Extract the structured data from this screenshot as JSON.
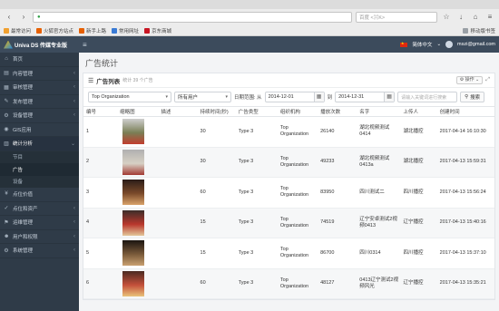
{
  "browser": {
    "url_hint": "百度 <⌘K>",
    "bookmarks": [
      {
        "label": "最常访问",
        "color": "#f0a030"
      },
      {
        "label": "火狐官方站点",
        "color": "#e66000"
      },
      {
        "label": "新手上路",
        "color": "#e66000"
      },
      {
        "label": "常用网址",
        "color": "#3a7bd5"
      },
      {
        "label": "京东商城",
        "color": "#c81623"
      }
    ],
    "mobile_bookmarks": "移动版书签"
  },
  "header": {
    "logo_text": "Univa DS 传媒专业版",
    "language": "简体中文",
    "user": "mszi@gmail.com"
  },
  "sidebar": {
    "items": [
      {
        "icon": "⌂",
        "label": "首页",
        "arrow": ""
      },
      {
        "icon": "▤",
        "label": "内容管理",
        "arrow": "‹"
      },
      {
        "icon": "▦",
        "label": "审核管理",
        "arrow": "‹"
      },
      {
        "icon": "✎",
        "label": "发布管理",
        "arrow": "‹"
      },
      {
        "icon": "⚙",
        "label": "设备管理",
        "arrow": "‹"
      },
      {
        "icon": "◉",
        "label": "GIS应用",
        "arrow": ""
      }
    ],
    "stats": {
      "icon": "▥",
      "label": "统计分析",
      "arrow": "⌄"
    },
    "sub_items": [
      "节目",
      "广告",
      "设备"
    ],
    "items_after": [
      {
        "icon": "¥",
        "label": "点位价值",
        "arrow": ""
      },
      {
        "icon": "✓",
        "label": "点位和资产",
        "arrow": "‹"
      },
      {
        "icon": "⚑",
        "label": "运维管理",
        "arrow": "‹"
      },
      {
        "icon": "☻",
        "label": "用户和权限",
        "arrow": "‹"
      },
      {
        "icon": "⚙",
        "label": "系统管理",
        "arrow": "‹"
      }
    ]
  },
  "main": {
    "page_title": "广告统计",
    "panel_title": "广告列表",
    "panel_subtitle": "统计 39 个广告",
    "ops_label": "操作"
  },
  "filters": {
    "organization": "Top Organization",
    "user": "所有用户",
    "date_label": "日期范围: 从",
    "date_from": "2014-12-01",
    "to_label": "到",
    "date_to": "2014-12-31",
    "keyword_placeholder": "请输入关键词进行搜索",
    "search_label": "搜索"
  },
  "table": {
    "headers": [
      "编号",
      "缩略图",
      "描述",
      "持续时间(秒)",
      "广告类型",
      "组织机构",
      "播放次数",
      "名字",
      "上传人",
      "创建时间"
    ],
    "rows": [
      {
        "id": "1",
        "desc": "",
        "duration": "30",
        "type": "Type 3",
        "org": "Top Organization",
        "plays": "26140",
        "name": "湖北视频测试0414",
        "uploader": "湖北播控",
        "created": "2017-04-14 16:10:30",
        "thumb": [
          "#cfcfcf",
          "#7a7f55",
          "#c23d2e"
        ]
      },
      {
        "id": "2",
        "desc": "",
        "duration": "30",
        "type": "Type 3",
        "org": "Top Organization",
        "plays": "49233",
        "name": "湖北视频测试0413a",
        "uploader": "湖北播控",
        "created": "2017-04-13 15:59:31",
        "thumb": [
          "#b0b0b0",
          "#d7d0c4",
          "#a33a33"
        ]
      },
      {
        "id": "3",
        "desc": "",
        "duration": "60",
        "type": "Type 3",
        "org": "Top Organization",
        "plays": "83950",
        "name": "四川测试二",
        "uploader": "四川播控",
        "created": "2017-04-13 15:56:24",
        "thumb": [
          "#2a1d18",
          "#7b4a2a",
          "#d9a36a"
        ]
      },
      {
        "id": "4",
        "desc": "",
        "duration": "15",
        "type": "Type 3",
        "org": "Top Organization",
        "plays": "74519",
        "name": "辽宁安卓测试2视频0413",
        "uploader": "辽宁播控",
        "created": "2017-04-13 15:40:16",
        "thumb": [
          "#3b2d2a",
          "#b9372c",
          "#e3c79a"
        ]
      },
      {
        "id": "5",
        "desc": "",
        "duration": "15",
        "type": "Type 3",
        "org": "Top Organization",
        "plays": "86700",
        "name": "四川0314",
        "uploader": "四川播控",
        "created": "2017-04-13 15:37:10",
        "thumb": [
          "#1a1410",
          "#7a5a3a",
          "#c9a070"
        ]
      },
      {
        "id": "6",
        "desc": "",
        "duration": "60",
        "type": "Type 3",
        "org": "Top Organization",
        "plays": "48127",
        "name": "0413辽宁测试2视频风光",
        "uploader": "辽宁播控",
        "created": "2017-04-13 15:35:21",
        "thumb": [
          "#4a2a22",
          "#c4503a",
          "#e9c27a"
        ]
      }
    ]
  }
}
